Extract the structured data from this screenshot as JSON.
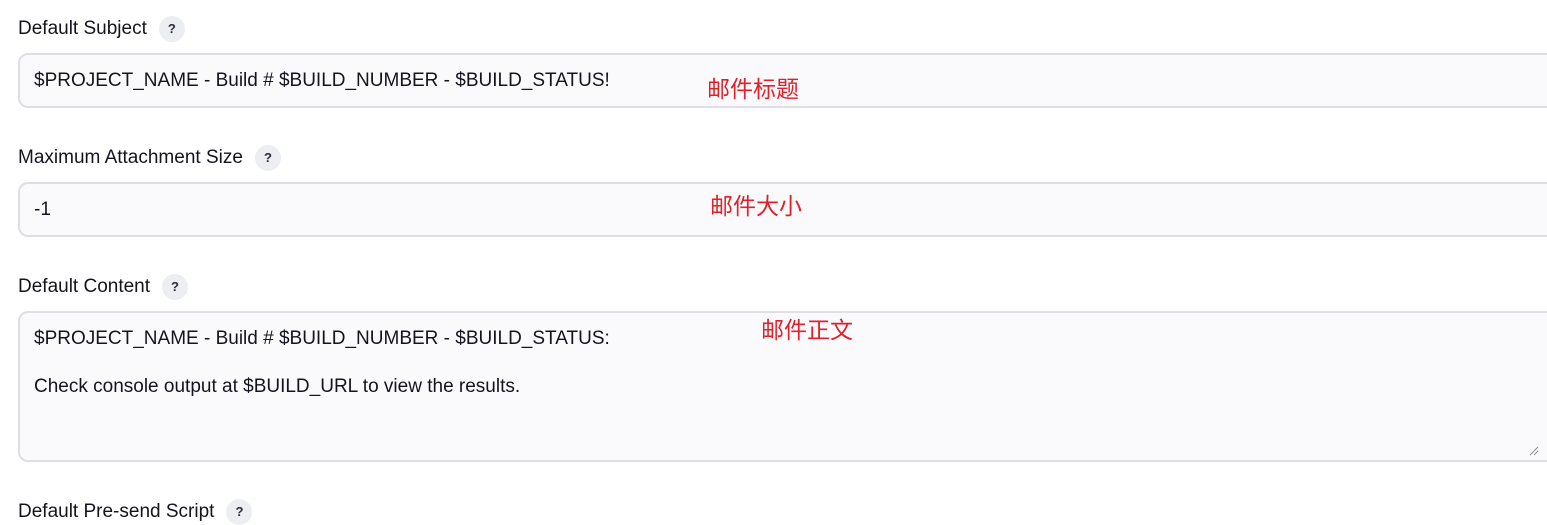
{
  "default_subject": {
    "label": "Default Subject",
    "help": "?",
    "value": "$PROJECT_NAME - Build # $BUILD_NUMBER - $BUILD_STATUS!",
    "annotation": "邮件标题"
  },
  "max_attachment_size": {
    "label": "Maximum Attachment Size",
    "help": "?",
    "value": "-1",
    "annotation": "邮件大小"
  },
  "default_content": {
    "label": "Default Content",
    "help": "?",
    "lines": [
      "$PROJECT_NAME - Build # $BUILD_NUMBER - $BUILD_STATUS:",
      "Check console output at $BUILD_URL to view the results."
    ],
    "annotation": "邮件正文"
  },
  "default_presend_script": {
    "label": "Default Pre-send Script",
    "help": "?"
  },
  "colors": {
    "annotation": "#e0202a",
    "field_border": "#dedee4",
    "field_background": "#fafafc",
    "help_badge": "#eceef2"
  }
}
